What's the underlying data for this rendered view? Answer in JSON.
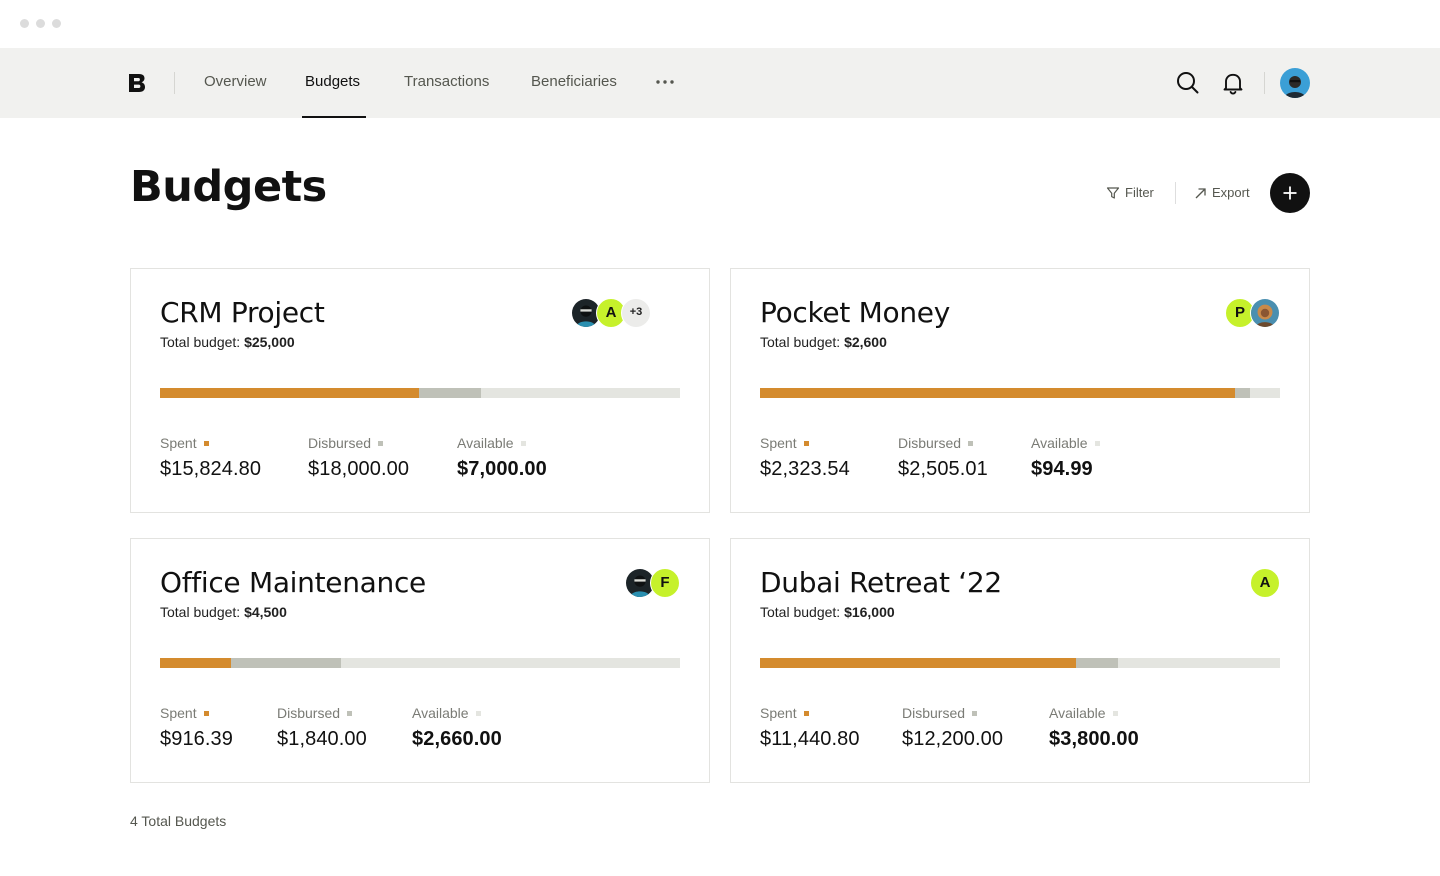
{
  "nav": {
    "items": [
      {
        "label": "Overview",
        "active": false
      },
      {
        "label": "Budgets",
        "active": true
      },
      {
        "label": "Transactions",
        "active": false
      },
      {
        "label": "Beneficiaries",
        "active": false
      }
    ],
    "more_icon": "more-horizontal-icon",
    "search_icon": "search-icon",
    "bell_icon": "bell-icon"
  },
  "page": {
    "title": "Budgets",
    "filter_label": "Filter",
    "export_label": "Export",
    "footer_count": "4 Total Budgets"
  },
  "colors": {
    "spent": "#d48b2e",
    "disbursed": "#bfc1b8",
    "available": "#e4e5e0",
    "accent_lime": "#c6f12b"
  },
  "budgets": [
    {
      "title": "CRM Project",
      "total_label": "Total budget:",
      "total": "$25,000",
      "spent_fraction": 0.498,
      "disbursed_fraction": 0.617,
      "spent_label": "Spent",
      "spent": "$15,824.80",
      "disbursed_label": "Disbursed",
      "disbursed": "$18,000.00",
      "available_label": "Available",
      "available": "$7,000.00",
      "avatars": [
        "photo",
        "A",
        "+3"
      ]
    },
    {
      "title": "Pocket Money",
      "total_label": "Total budget:",
      "total": "$2,600",
      "spent_fraction": 0.913,
      "disbursed_fraction": 0.942,
      "spent_label": "Spent",
      "spent": "$2,323.54",
      "disbursed_label": "Disbursed",
      "disbursed": "$2,505.01",
      "available_label": "Available",
      "available": "$94.99",
      "avatars": [
        "P",
        "photo"
      ]
    },
    {
      "title": "Office Maintenance",
      "total_label": "Total budget:",
      "total": "$4,500",
      "spent_fraction": 0.137,
      "disbursed_fraction": 0.348,
      "spent_label": "Spent",
      "spent": "$916.39",
      "disbursed_label": "Disbursed",
      "disbursed": "$1,840.00",
      "available_label": "Available",
      "available": "$2,660.00",
      "avatars": [
        "photo",
        "F"
      ]
    },
    {
      "title": "Dubai Retreat ‘22",
      "total_label": "Total budget:",
      "total": "$16,000",
      "spent_fraction": 0.608,
      "disbursed_fraction": 0.688,
      "spent_label": "Spent",
      "spent": "$11,440.80",
      "disbursed_label": "Disbursed",
      "disbursed": "$12,200.00",
      "available_label": "Available",
      "available": "$3,800.00",
      "avatars": [
        "A"
      ]
    }
  ]
}
